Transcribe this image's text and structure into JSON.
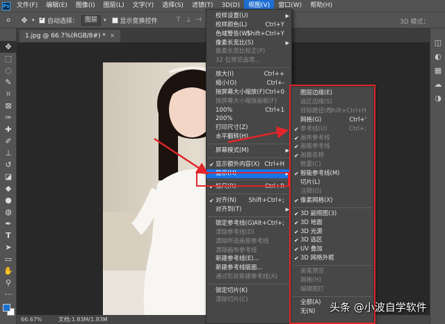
{
  "menubar": {
    "logo": "Ps",
    "items": [
      "文件(F)",
      "编辑(E)",
      "图像(I)",
      "图层(L)",
      "文字(Y)",
      "选择(S)",
      "滤镜(T)",
      "3D(D)",
      "视图(V)",
      "窗口(W)",
      "帮助(H)"
    ]
  },
  "options": {
    "auto_select_label": "自动选择：",
    "auto_select_value": "图层",
    "show_transform_label": "显示变换控件",
    "mode_3d_label": "3D 模式："
  },
  "document": {
    "tab_title": "1.jpg @ 66.7%(RGB/8#) *",
    "zoom": "66.67%",
    "doc_info": "文档:1.83M/1.83M"
  },
  "view_menu": {
    "items": [
      {
        "label": "校样设置(U)",
        "shortcut": "",
        "arrow": true
      },
      {
        "label": "校样颜色(L)",
        "shortcut": "Ctrl+Y"
      },
      {
        "label": "色域警告(W)",
        "shortcut": "Shift+Ctrl+Y"
      },
      {
        "label": "像素长宽比(S)",
        "shortcut": "",
        "arrow": true
      },
      {
        "label": "像素长宽比校正(P)",
        "shortcut": "",
        "disabled": true
      },
      {
        "label": "32 位预览选项...",
        "shortcut": "",
        "disabled": true
      },
      {
        "sep": true
      },
      {
        "label": "放大(I)",
        "shortcut": "Ctrl++"
      },
      {
        "label": "缩小(O)",
        "shortcut": "Ctrl+-"
      },
      {
        "label": "按屏幕大小缩放(F)",
        "shortcut": "Ctrl+0"
      },
      {
        "label": "按屏幕大小缩放画板(F)",
        "shortcut": "",
        "disabled": true
      },
      {
        "label": "100%",
        "shortcut": "Ctrl+1"
      },
      {
        "label": "200%",
        "shortcut": ""
      },
      {
        "label": "打印尺寸(Z)",
        "shortcut": ""
      },
      {
        "label": "水平翻转(H)",
        "shortcut": ""
      },
      {
        "sep": true
      },
      {
        "label": "屏幕模式(M)",
        "shortcut": "",
        "arrow": true
      },
      {
        "sep": true
      },
      {
        "label": "显示额外内容(X)",
        "shortcut": "Ctrl+H",
        "checked": true
      },
      {
        "label": "显示(H)",
        "shortcut": "",
        "arrow": true,
        "highlight": true
      },
      {
        "sep": true
      },
      {
        "label": "标尺(R)",
        "shortcut": "Ctrl+R",
        "checked": true
      },
      {
        "sep": true
      },
      {
        "label": "对齐(N)",
        "shortcut": "Shift+Ctrl+;",
        "checked": true
      },
      {
        "label": "对齐到(T)",
        "shortcut": "",
        "arrow": true
      },
      {
        "sep": true
      },
      {
        "label": "锁定参考线(G)",
        "shortcut": "Alt+Ctrl+;"
      },
      {
        "label": "清除参考线(D)",
        "shortcut": "",
        "disabled": true
      },
      {
        "label": "清除所选画板参考线",
        "shortcut": "",
        "disabled": true
      },
      {
        "label": "清除画布参考线",
        "shortcut": "",
        "disabled": true
      },
      {
        "label": "新建参考线(E)...",
        "shortcut": ""
      },
      {
        "label": "新建参考线版面...",
        "shortcut": ""
      },
      {
        "label": "通过形状新建参考线(A)",
        "shortcut": "",
        "disabled": true
      },
      {
        "sep": true
      },
      {
        "label": "锁定切片(K)",
        "shortcut": ""
      },
      {
        "label": "清除切片(C)",
        "shortcut": "",
        "disabled": true
      }
    ]
  },
  "show_submenu": {
    "items": [
      {
        "label": "图层边缘(E)"
      },
      {
        "label": "选区边缘(S)",
        "disabled": true
      },
      {
        "label": "目标路径(P)",
        "shortcut": "Shift+Ctrl+H",
        "disabled": true
      },
      {
        "label": "网格(G)",
        "shortcut": "Ctrl+'"
      },
      {
        "label": "参考线(U)",
        "shortcut": "Ctrl+;",
        "checked": true,
        "disabled": true
      },
      {
        "label": "画布参考线",
        "checked": true,
        "disabled": true
      },
      {
        "label": "画板参考线",
        "checked": true,
        "disabled": true
      },
      {
        "label": "画板名称",
        "checked": true,
        "disabled": true
      },
      {
        "label": "数量(C)",
        "disabled": true
      },
      {
        "label": "智能参考线(M)",
        "checked": true
      },
      {
        "label": "切片(L)"
      },
      {
        "label": "注释(O)",
        "disabled": true
      },
      {
        "label": "像素网格(X)",
        "checked": true
      },
      {
        "sep": true
      },
      {
        "label": "3D 副视图(3)",
        "checked": true
      },
      {
        "label": "3D 地面",
        "checked": true
      },
      {
        "label": "3D 光源",
        "checked": true
      },
      {
        "label": "3D 选区",
        "checked": true
      },
      {
        "label": "UV 叠加",
        "checked": true
      },
      {
        "label": "3D 网格外框",
        "checked": true
      },
      {
        "sep": true
      },
      {
        "label": "画笔预览",
        "disabled": true
      },
      {
        "label": "网格(H)",
        "disabled": true
      },
      {
        "label": "编辑图钉",
        "disabled": true
      },
      {
        "sep": true
      },
      {
        "label": "全部(A)"
      },
      {
        "label": "无(N)"
      }
    ]
  },
  "watermark": "头条 @小波自学软件",
  "colors": {
    "accent": "#1773e6",
    "annotation": "#e0262a"
  }
}
